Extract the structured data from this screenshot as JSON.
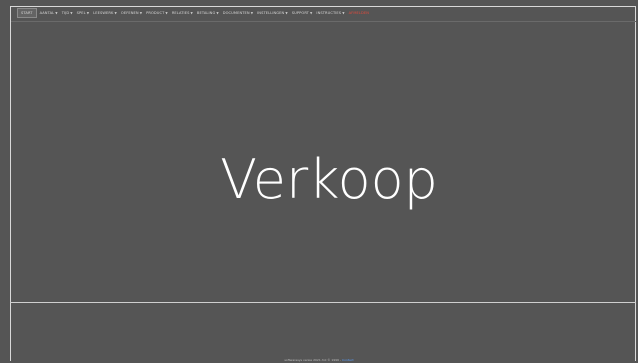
{
  "menu": {
    "home": "Start",
    "items": [
      "Aantal",
      "Tijd",
      "Spel",
      "Leeswerk",
      "Oefenen",
      "Product",
      "Relaties",
      "Betaling",
      "Documenten",
      "Instellingen",
      "Support",
      "Instructies"
    ],
    "last": "Afmelden"
  },
  "page": {
    "title": "Verkoop"
  },
  "footer": {
    "text": "softwaresys versie 2021.3.0 © 1996 -",
    "link": "Contact"
  },
  "colors": {
    "background": "#555555",
    "text": "#ffffff",
    "accent_red": "#e24a3d",
    "link": "#5aa0ff"
  }
}
